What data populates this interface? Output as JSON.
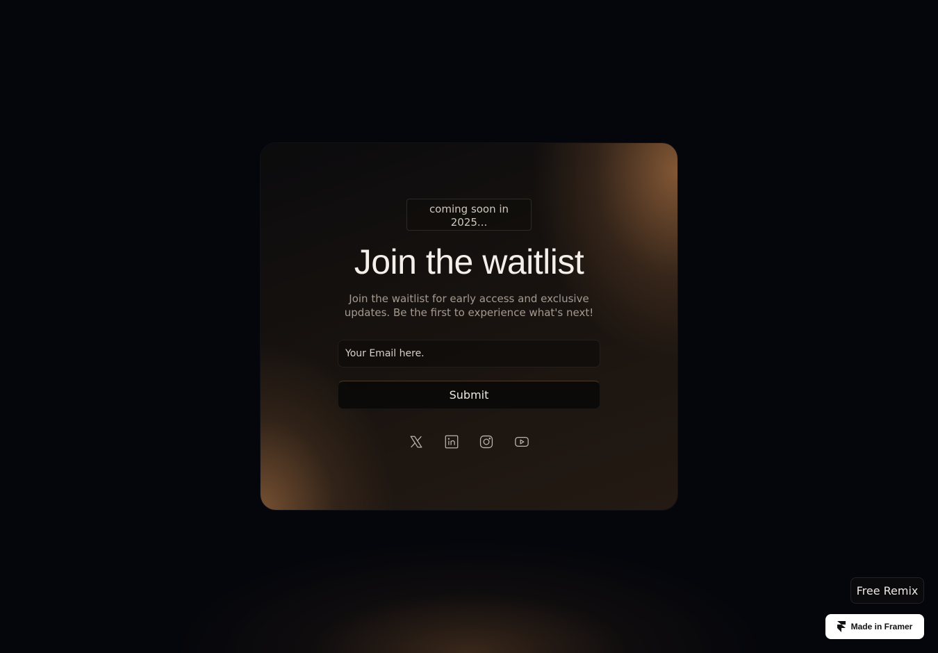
{
  "badge": {
    "line1": "coming soon in",
    "line2": "2025..."
  },
  "hero": {
    "title": "Join the waitlist",
    "subtitle": "Join the waitlist for early access and exclusive updates. Be the first to experience what's next!"
  },
  "form": {
    "email_placeholder": "Your Email here.",
    "submit_label": "Submit"
  },
  "socials": [
    {
      "name": "x",
      "icon": "x-icon"
    },
    {
      "name": "linkedin",
      "icon": "linkedin-icon"
    },
    {
      "name": "instagram",
      "icon": "instagram-icon"
    },
    {
      "name": "youtube",
      "icon": "youtube-icon"
    }
  ],
  "footer": {
    "remix_label": "Free Remix",
    "framer_label": "Made in Framer"
  },
  "colors": {
    "background": "#05060b",
    "accent_bronze": "#96643c",
    "text_primary": "#f4efe9",
    "text_muted": "#a59a90"
  }
}
